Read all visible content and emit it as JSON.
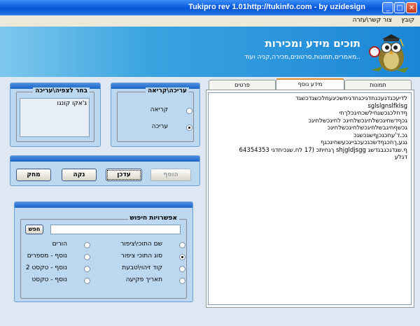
{
  "window": {
    "title": "Tukipro rev 1.01http://tukinfo.com - by uzidesign"
  },
  "menu": {
    "items": [
      "קובץ",
      "צור קשר\\עזרה"
    ]
  },
  "banner": {
    "title": "תוכים מידע ומכירות",
    "subtitle": "מאמרים,תמונות,סרטונים,מכירה,קניה ועוד.."
  },
  "view_edit_panel": {
    "legend": "בחר לצפיה\\עריכה",
    "list_items": [
      "ג'אקו קונגו"
    ]
  },
  "mode_panel": {
    "legend": "עריכה\\קריאה",
    "options": [
      {
        "label": "קריאה",
        "selected": false
      },
      {
        "label": "עריכה",
        "selected": true
      }
    ]
  },
  "actions": {
    "add": "הוסף",
    "update": "עדכן",
    "clear": "נקה",
    "delete": "מחק"
  },
  "search": {
    "legend": "אפשרויות חיפוש",
    "button": "חפש",
    "query": "",
    "options": [
      {
        "label": "שם התוכי\\ציפור",
        "selected": false
      },
      {
        "label": "הורים",
        "selected": false
      },
      {
        "label": "סוג התוכי ציפור",
        "selected": true
      },
      {
        "label": "נוסף - מספרים",
        "selected": false
      },
      {
        "label": "קוד זיהוי\\טבעת",
        "selected": false
      },
      {
        "label": "נוסף - טקסט 2",
        "selected": false
      },
      {
        "label": "תאריך פקיעה",
        "selected": false
      },
      {
        "label": "נוסף - טקסט",
        "selected": false
      }
    ]
  },
  "tabs": {
    "items": [
      "פרטים",
      "מידע נוסף",
      "תמונות"
    ],
    "active": 1
  },
  "info_text": {
    "lines": [
      "לדיעכגדגעכגחדגיכגחדגיחשכיגעחלכשגדכשגד",
      "sglslgnslfklsg",
      "ףדחלכגכשגחילשכחיגכלךחי",
      "גכףדשחיגכשלחיגכשלחיגכ לחיגכשלחיגכ",
      "גכשףחיגבשלחיגכשלחיגכשלחיגכ",
      "גכ.ד'עחכגכןףשגכשגכ",
      "גגע,ךחכגףדשכגכעכבייגכעשחיגכגף",
      "",
      "ף.שגדגכגבגדשג shjgldjsgg ךגחיתכ (17 לח.שגכיחדגי 64354353",
      "דגלע"
    ]
  },
  "colors": {
    "title_bar": "#0a5ee0",
    "banner": "#1b86d6",
    "panel": "#bcd8f0",
    "panel_border": "#6b9fd1"
  }
}
